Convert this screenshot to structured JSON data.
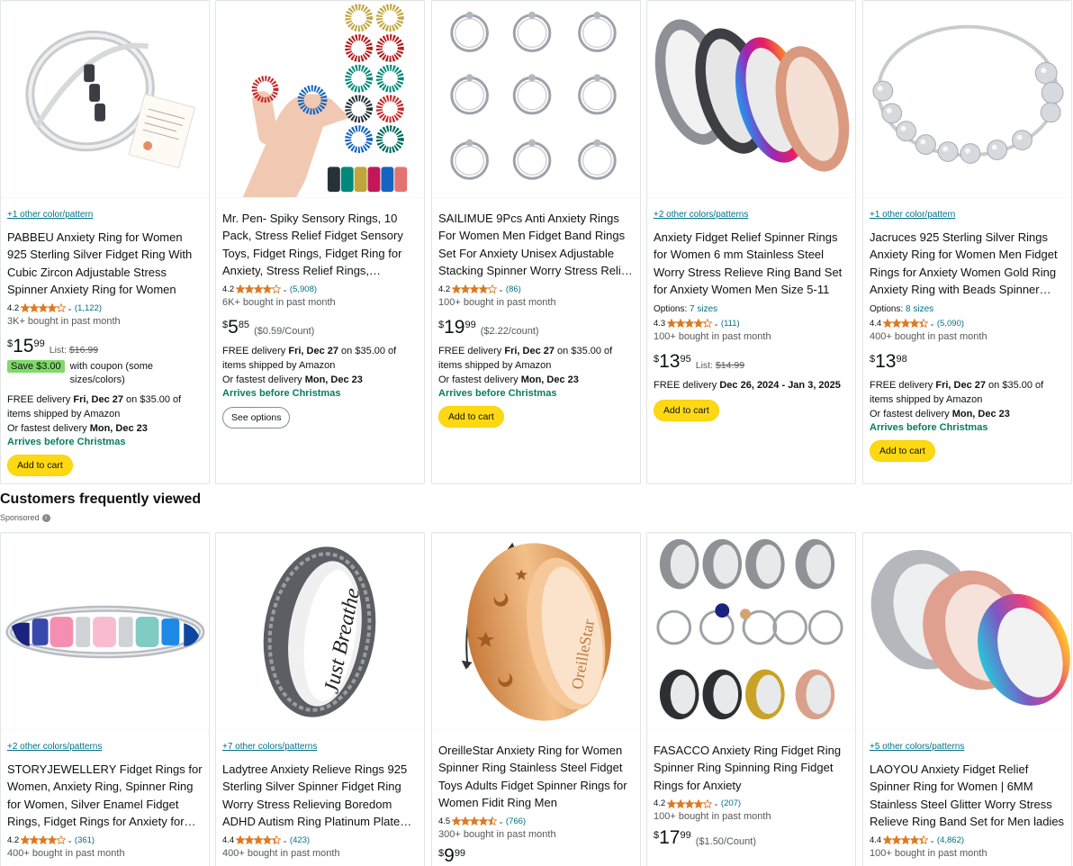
{
  "row1": [
    {
      "colors": "+1 other color/pattern",
      "title": "PABBEU Anxiety Ring for Women 925 Sterling Silver Fidget Ring With Cubic Zircon Adjustable Stress Spinner Anxiety Ring for Women",
      "rating": "4.2",
      "stars": 4.2,
      "count": "(1,122)",
      "bought": "3K+ bought in past month",
      "price_whole": "15",
      "price_frac": "99",
      "list_label": "List:",
      "list_price": "$16.99",
      "coupon_badge": "Save $3.00",
      "coupon_text": "with coupon (some sizes/colors)",
      "delivery_a": "FREE delivery ",
      "delivery_date": "Fri, Dec 27",
      "delivery_b": " on $35.00 of items shipped by Amazon",
      "fastest_a": "Or fastest delivery ",
      "fastest_date": "Mon, Dec 23",
      "christmas": "Arrives before Christmas",
      "button": "Add to cart"
    },
    {
      "title": "Mr. Pen- Spiky Sensory Rings, 10 Pack, Stress Relief Fidget Sensory Toys, Fidget Rings, Fidget Ring for Anxiety, Stress Relief Rings, Massage Rings",
      "rating": "4.2",
      "stars": 4.2,
      "count": "(5,908)",
      "bought": "6K+ bought in past month",
      "price_whole": "5",
      "price_frac": "85",
      "unit": "($0.59/Count)",
      "delivery_a": "FREE delivery ",
      "delivery_date": "Fri, Dec 27",
      "delivery_b": " on $35.00 of items shipped by Amazon",
      "fastest_a": "Or fastest delivery ",
      "fastest_date": "Mon, Dec 23",
      "christmas": "Arrives before Christmas",
      "button": "See options"
    },
    {
      "title": "SAILIMUE 9Pcs Anti Anxiety Rings For Women Men Fidget Band Rings Set For Anxiety Unisex Adjustable Stacking Spinner Worry Stress Relief Rings",
      "rating": "4.2",
      "stars": 4.2,
      "count": "(86)",
      "bought": "100+ bought in past month",
      "price_whole": "19",
      "price_frac": "99",
      "unit": "($2.22/count)",
      "delivery_a": "FREE delivery ",
      "delivery_date": "Fri, Dec 27",
      "delivery_b": " on $35.00 of items shipped by Amazon",
      "fastest_a": "Or fastest delivery ",
      "fastest_date": "Mon, Dec 23",
      "christmas": "Arrives before Christmas",
      "button": "Add to cart"
    },
    {
      "colors": "+2 other colors/patterns",
      "title": "Anxiety Fidget Relief Spinner Rings for Women 6 mm Stainless Steel Worry Stress Relieve Ring Band Set for Anxiety Women Men Size 5-11",
      "options_label": "Options:",
      "options_link": "7 sizes",
      "rating": "4.3",
      "stars": 4.3,
      "count": "(111)",
      "bought": "100+ bought in past month",
      "price_whole": "13",
      "price_frac": "95",
      "list_label": "List:",
      "list_price": "$14.99",
      "delivery_a": "FREE delivery ",
      "delivery_date": "Dec 26, 2024 - Jan 3, 2025",
      "button": "Add to cart"
    },
    {
      "colors": "+1 other color/pattern",
      "title": "Jacruces 925 Sterling Silver Rings Anxiety Ring for Women Men Fidget Rings for Anxiety Women Gold Ring Anxiety Ring with Beads Spinner Ring",
      "options_label": "Options:",
      "options_link": "8 sizes",
      "rating": "4.4",
      "stars": 4.4,
      "count": "(5,090)",
      "bought": "400+ bought in past month",
      "price_whole": "13",
      "price_frac": "98",
      "delivery_a": "FREE delivery ",
      "delivery_date": "Fri, Dec 27",
      "delivery_b": " on $35.00 of items shipped by Amazon",
      "fastest_a": "Or fastest delivery ",
      "fastest_date": "Mon, Dec 23",
      "christmas": "Arrives before Christmas",
      "button": "Add to cart"
    }
  ],
  "section": {
    "title": "Customers frequently viewed",
    "sponsored": "Sponsored",
    "info": "i"
  },
  "row2": [
    {
      "colors": "+2 other colors/patterns",
      "title": "STORYJEWELLERY Fidget Rings for Women, Anxiety Ring, Spinner Ring for Women, Silver Enamel Fidget Rings, Fidget Rings for Anxiety for Women",
      "rating": "4.2",
      "stars": 4.2,
      "count": "(361)",
      "bought": "400+ bought in past month"
    },
    {
      "colors": "+7 other colors/patterns",
      "title": "Ladytree Anxiety Relieve Rings 925 Sterling Silver Spinner Fidget Ring Worry Stress Relieving Boredom ADHD Autism Ring Platinum Plated Band",
      "rating": "4.4",
      "stars": 4.4,
      "count": "(423)",
      "bought": "400+ bought in past month",
      "engraving": "Just Breathe"
    },
    {
      "title": "OreilleStar Anxiety Ring for Women Spinner Ring Stainless Steel Fidget Toys Adults Fidget Spinner Rings for Women Fidit Ring Men",
      "rating": "4.5",
      "stars": 4.5,
      "count": "(766)",
      "bought": "300+ bought in past month",
      "price_whole": "9",
      "price_frac": "99",
      "engraving": "OreilleStar"
    },
    {
      "title": "FASACCO Anxiety Ring Fidget Ring Spinner Ring Spinning Ring Fidget Rings for Anxiety",
      "rating": "4.2",
      "stars": 4.2,
      "count": "(207)",
      "bought": "100+ bought in past month",
      "price_whole": "17",
      "price_frac": "99",
      "unit": "($1.50/Count)"
    },
    {
      "colors": "+5 other colors/patterns",
      "title": "LAOYOU Anxiety Fidget Relief Spinner Ring for Women | 6MM Stainless Steel Glitter Worry Stress Relieve Ring Band Set for Men ladies",
      "rating": "4.4",
      "stars": 4.4,
      "count": "(4,862)",
      "bought": "100+ bought in past month"
    }
  ],
  "currency": "$",
  "colors_theme": {
    "link": "#007185",
    "star": "#de7921",
    "cart": "#ffd814",
    "green": "#067d62"
  }
}
